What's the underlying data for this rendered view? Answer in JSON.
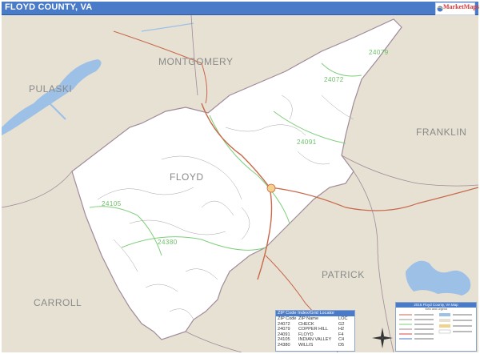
{
  "title": "FLOYD COUNTY, VA",
  "logo": {
    "main": "MarketMaps",
    "sub": ""
  },
  "county_labels": {
    "floyd": "FLOYD",
    "montgomery": "MONTGOMERY",
    "pulaski": "PULASKI",
    "franklin": "FRANKLIN",
    "carroll": "CARROLL",
    "patrick": "PATRICK"
  },
  "zip_labels": {
    "z24079": "24079",
    "z24072": "24072",
    "z24091": "24091",
    "z24105": "24105",
    "z24380": "24380"
  },
  "zip_table": {
    "header": "ZIP Code Index/Grid Locator",
    "columns": [
      "ZIP Code",
      "ZIP Name",
      "LOC"
    ],
    "rows": [
      [
        "24072",
        "CHECK",
        "G2"
      ],
      [
        "24079",
        "COPPER HILL",
        "H2"
      ],
      [
        "24091",
        "FLOYD",
        "F4"
      ],
      [
        "24105",
        "INDIAN VALLEY",
        "C4"
      ],
      [
        "24380",
        "WILLIS",
        "D5"
      ]
    ]
  },
  "key": {
    "header": "2016 Floyd County, VA Map",
    "subheader": "View and Legend"
  },
  "colors": {
    "title_bar": "#4a7bc8",
    "county_fill": "#ffffff",
    "outside_fill": "#e6e1d3",
    "water": "#9cc0e6",
    "highway": "#c8674a",
    "zip_boundary": "#7fcf7a",
    "county_boundary": "#a08a9a"
  }
}
